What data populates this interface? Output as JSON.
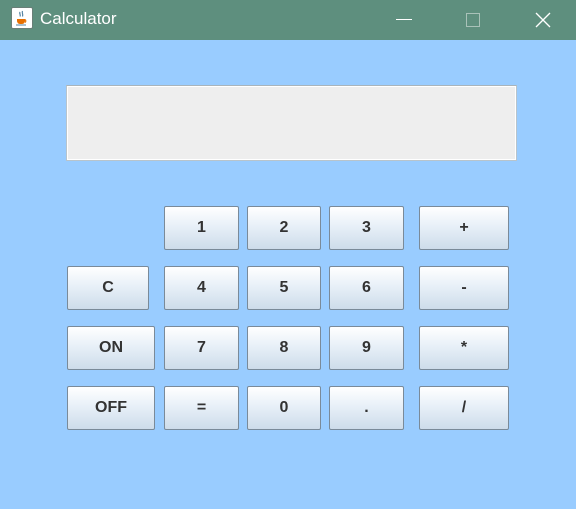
{
  "window": {
    "title": "Calculator",
    "icon": "java-cup-icon",
    "controls": [
      "minimize-icon",
      "maximize-icon",
      "close-icon"
    ]
  },
  "display": {
    "value": ""
  },
  "keys": {
    "one": "1",
    "two": "2",
    "three": "3",
    "plus": "+",
    "clear": "C",
    "four": "4",
    "five": "5",
    "six": "6",
    "minus": "-",
    "on": "ON",
    "seven": "7",
    "eight": "8",
    "nine": "9",
    "multiply": "*",
    "off": "OFF",
    "equals": "=",
    "zero": "0",
    "dot": ".",
    "divide": "/"
  },
  "colors": {
    "titlebar": "#5e8f7e",
    "background": "#99ccff",
    "display": "#eeeeee"
  }
}
